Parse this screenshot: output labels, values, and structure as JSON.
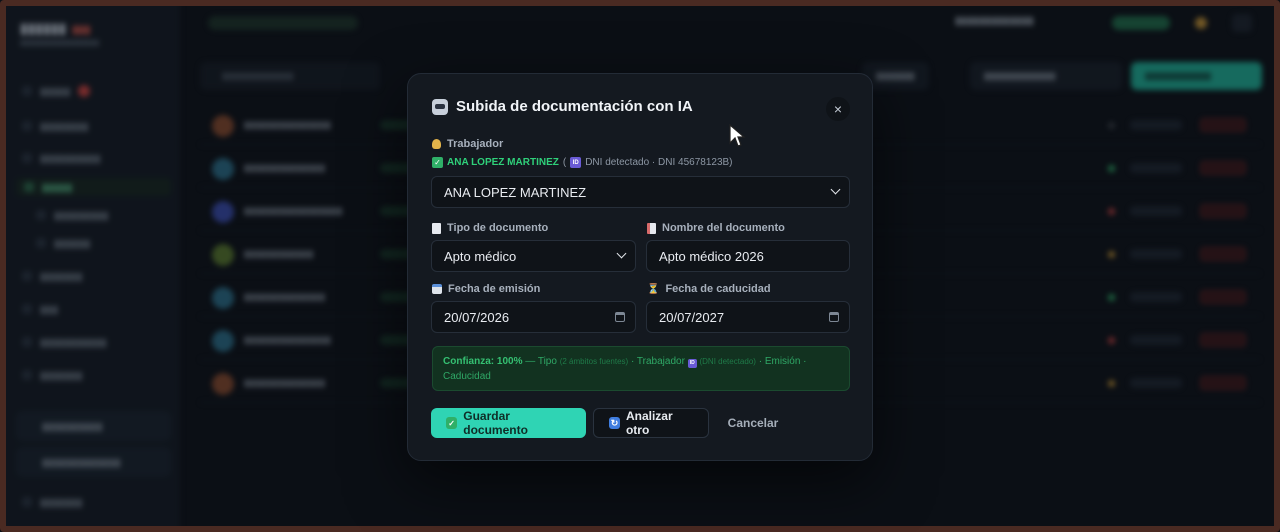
{
  "modal": {
    "title": "Subida de documentación con IA",
    "close_glyph": "×",
    "worker": {
      "label": "Trabajador",
      "detected_name": "ANA LOPEZ MARTINEZ",
      "detected_open": "(",
      "detected_text": "DNI detectado · DNI 45678123B)",
      "selected": "ANA LOPEZ MARTINEZ"
    },
    "doc_type": {
      "label": "Tipo de documento",
      "value": "Apto médico"
    },
    "doc_name": {
      "label": "Nombre del documento",
      "value": "Apto médico 2026"
    },
    "issue_date": {
      "label": "Fecha de emisión",
      "value": "20/07/2026"
    },
    "expiry_date": {
      "label": "Fecha de caducidad",
      "value": "20/07/2027"
    },
    "confidence": {
      "strong": "Confianza: 100%",
      "sep": " — Tipo ",
      "type_note": "(2 ámbitos fuentes)",
      "mid": " · Trabajador ",
      "worker_note": "(DNI detectado)",
      "tail": " · Emisión · Caducidad"
    },
    "buttons": {
      "save": "Guardar documento",
      "analyze": "Analizar otro",
      "cancel": "Cancelar"
    }
  },
  "icons": {
    "title": "ai-robot-icon",
    "worker": "worker-icon",
    "detected": "check-icon",
    "id": "id-card-icon",
    "doc_type": "document-icon",
    "doc_name": "document-name-icon",
    "issue": "calendar-icon",
    "expiry": "hourglass-icon",
    "save": "check-icon",
    "analyze": "refresh-icon"
  },
  "colors": {
    "accent": "#2fd4b4",
    "success": "#2fd07a",
    "surface": "#141920"
  }
}
